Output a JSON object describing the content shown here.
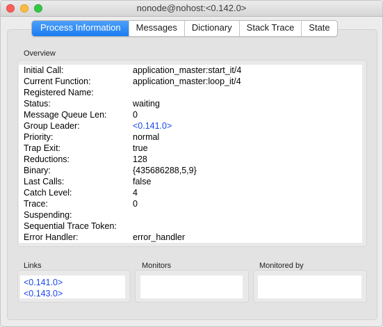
{
  "window": {
    "title": "nonode@nohost:<0.142.0>"
  },
  "tabs": [
    {
      "label": "Process Information",
      "active": true
    },
    {
      "label": "Messages",
      "active": false
    },
    {
      "label": "Dictionary",
      "active": false
    },
    {
      "label": "Stack Trace",
      "active": false
    },
    {
      "label": "State",
      "active": false
    }
  ],
  "overview": {
    "label": "Overview",
    "rows": [
      {
        "key": "Initial Call:",
        "value": "application_master:start_it/4"
      },
      {
        "key": "Current Function:",
        "value": "application_master:loop_it/4"
      },
      {
        "key": "Registered Name:",
        "value": ""
      },
      {
        "key": "Status:",
        "value": "waiting"
      },
      {
        "key": "Message Queue Len:",
        "value": "0"
      },
      {
        "key": "Group Leader:",
        "value": "<0.141.0>",
        "link": true
      },
      {
        "key": "Priority:",
        "value": "normal"
      },
      {
        "key": "Trap Exit:",
        "value": "true"
      },
      {
        "key": "Reductions:",
        "value": "128"
      },
      {
        "key": "Binary:",
        "value": "{435686288,5,9}"
      },
      {
        "key": "Last Calls:",
        "value": "false"
      },
      {
        "key": "Catch Level:",
        "value": "4"
      },
      {
        "key": "Trace:",
        "value": "0"
      },
      {
        "key": "Suspending:",
        "value": ""
      },
      {
        "key": "Sequential Trace Token:",
        "value": ""
      },
      {
        "key": "Error Handler:",
        "value": "error_handler"
      }
    ]
  },
  "links": {
    "label": "Links",
    "items": [
      "<0.141.0>",
      "<0.143.0>"
    ]
  },
  "monitors": {
    "label": "Monitors",
    "items": []
  },
  "monitored_by": {
    "label": "Monitored by",
    "items": []
  },
  "colors": {
    "link": "#1947e8",
    "tab_active": "#1a7cf0"
  }
}
